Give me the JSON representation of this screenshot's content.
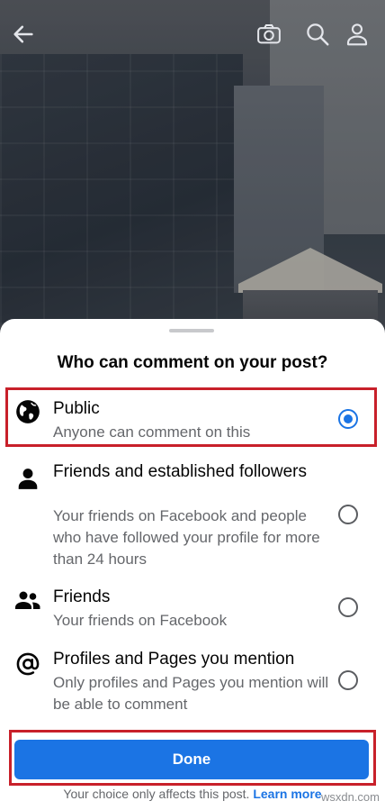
{
  "icons": {
    "back": "arrow-left-icon",
    "camera": "camera-icon",
    "search": "search-icon",
    "profile": "person-icon"
  },
  "sheet": {
    "title": "Who can comment on your post?",
    "options": [
      {
        "icon": "globe-icon",
        "title": "Public",
        "description": "Anyone can comment on this",
        "selected": true
      },
      {
        "icon": "person-icon",
        "title": "Friends and established followers",
        "description": "Your friends on Facebook and people who have followed your profile for more than 24 hours",
        "selected": false
      },
      {
        "icon": "people-icon",
        "title": "Friends",
        "description": "Your friends on Facebook",
        "selected": false
      },
      {
        "icon": "at-sign-icon",
        "title": "Profiles and Pages you mention",
        "description": "Only profiles and Pages you mention will be able to comment",
        "selected": false
      }
    ],
    "done_label": "Done",
    "footer_text": "Your choice only affects this post.",
    "footer_link": "Learn more"
  },
  "watermark": "wsxdn.com",
  "colors": {
    "accent": "#1b74e4",
    "highlight": "#c8202a"
  }
}
